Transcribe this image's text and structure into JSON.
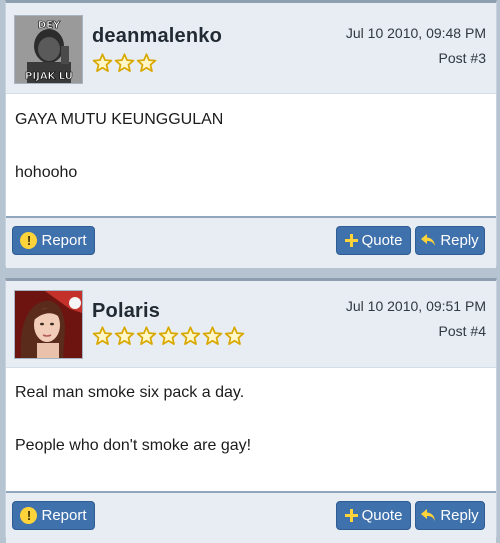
{
  "posts": [
    {
      "username": "deanmalenko",
      "avatar_text_top": "DEY",
      "avatar_text_bottom": "PIJAK LU",
      "date": "Jul 10 2010, 09:48 PM",
      "post_number": "Post #3",
      "stars": 3,
      "body": [
        "GAYA MUTU KEUNGGULAN",
        "hohooho"
      ],
      "actions": {
        "report": "Report",
        "quote": "Quote",
        "reply": "Reply"
      }
    },
    {
      "username": "Polaris",
      "date": "Jul 10 2010, 09:51 PM",
      "post_number": "Post #4",
      "stars": 7,
      "body": [
        "Real man smoke six pack a day.",
        "People who don't smoke are gay!"
      ],
      "actions": {
        "report": "Report",
        "quote": "Quote",
        "reply": "Reply"
      }
    }
  ],
  "colors": {
    "button": "#3f71ac",
    "header": "#e7edf3",
    "separator": "#8e9fb1",
    "star_fill": "#fff7c8",
    "star_stroke": "#d9a800"
  }
}
